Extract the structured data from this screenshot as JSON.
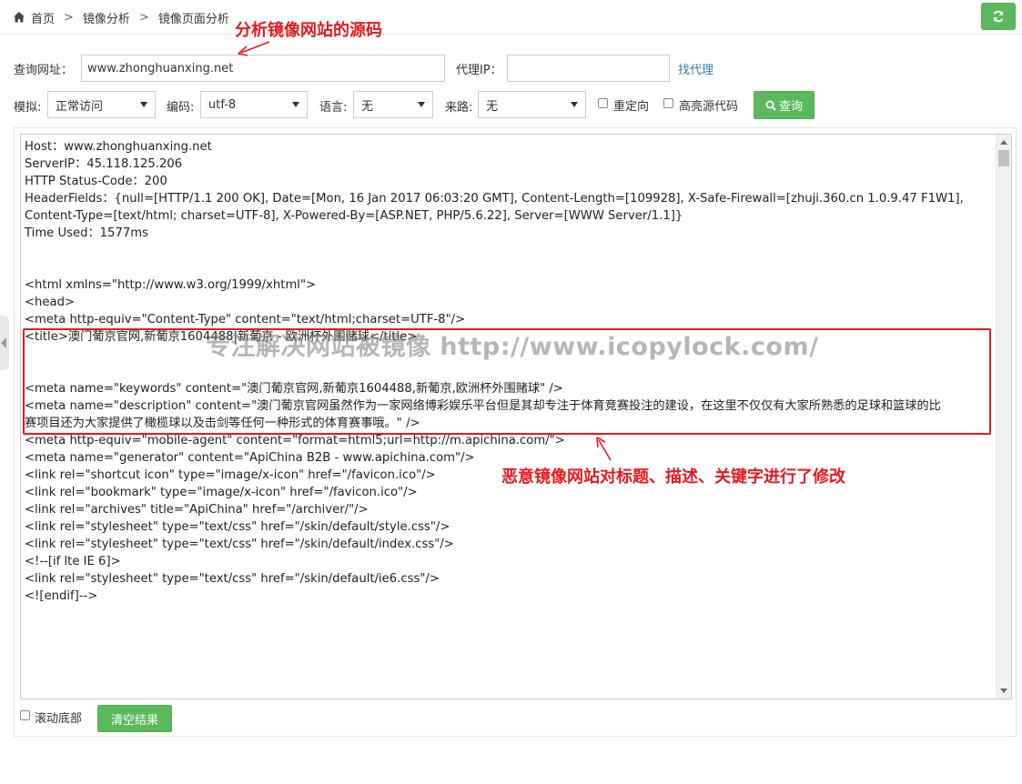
{
  "breadcrumb": {
    "items": [
      "首页",
      "镜像分析",
      "镜像页面分析"
    ],
    "separator": ">"
  },
  "form": {
    "url_label": "查询网址：",
    "url_value": "www.zhonghuanxing.net",
    "proxy_label": "代理IP：",
    "proxy_value": "",
    "find_proxy_link": "找代理",
    "mode_label": "模拟:",
    "mode_value": "正常访问",
    "encoding_label": "编码:",
    "encoding_value": "utf-8",
    "language_label": "语言:",
    "language_value": "无",
    "referrer_label": "来路:",
    "referrer_value": "无",
    "redirect_label": "重定向",
    "highlight_label": "高亮源代码",
    "query_button": "查询"
  },
  "result": {
    "lines": [
      "Host：www.zhonghuanxing.net",
      "ServerIP：45.118.125.206",
      "HTTP Status-Code：200",
      "HeaderFields：{null=[HTTP/1.1 200 OK], Date=[Mon, 16 Jan 2017 06:03:20 GMT], Content-Length=[109928], X-Safe-Firewall=[zhuji.360.cn 1.0.9.47 F1W1],",
      "Content-Type=[text/html; charset=UTF-8], X-Powered-By=[ASP.NET, PHP/5.6.22], Server=[WWW Server/1.1]}",
      "Time Used：1577ms",
      "",
      "",
      "<html xmlns=\"http://www.w3.org/1999/xhtml\">",
      "<head>",
      "<meta http-equiv=\"Content-Type\" content=\"text/html;charset=UTF-8\"/>",
      "<title>澳门葡京官网,新葡京1604488|新葡京 - 欧洲杯外围赌球</title>",
      "",
      "",
      "<meta name=\"keywords\" content=\"澳门葡京官网,新葡京1604488,新葡京,欧洲杯外围赌球\" />",
      "<meta name=\"description\" content=\"澳门葡京官网虽然作为一家网络博彩娱乐平台但是其却专注于体育竞赛投注的建设，在这里不仅仅有大家所熟悉的足球和篮球的比",
      "赛项目还为大家提供了橄榄球以及击剑等任何一种形式的体育赛事哦。\" />",
      "<meta http-equiv=\"mobile-agent\" content=\"format=html5;url=http://m.apichina.com/\">",
      "<meta name=\"generator\" content=\"ApiChina B2B - www.apichina.com\"/>",
      "<link rel=\"shortcut icon\" type=\"image/x-icon\" href=\"/favicon.ico\"/>",
      "<link rel=\"bookmark\" type=\"image/x-icon\" href=\"/favicon.ico\"/>",
      "<link rel=\"archives\" title=\"ApiChina\" href=\"/archiver/\"/>",
      "<link rel=\"stylesheet\" type=\"text/css\" href=\"/skin/default/style.css\"/>",
      "<link rel=\"stylesheet\" type=\"text/css\" href=\"/skin/default/index.css\"/>",
      "<!--[if lte IE 6]>",
      "<link rel=\"stylesheet\" type=\"text/css\" href=\"/skin/default/ie6.css\"/>",
      "<![endif]-->"
    ]
  },
  "bottom": {
    "scroll_bottom_label": "滚动底部",
    "clear_button": "清空结果"
  },
  "annotations": {
    "title_note": "分析镜像网站的源码",
    "watermark": "专注解决网站被镜像 http://www.icopylock.com/",
    "bottom_note": "恶意镜像网站对标题、描述、关键字进行了修改"
  },
  "colors": {
    "green_button": "#5cb85c",
    "annotation_red": "#e8191c",
    "link_blue": "#337ab7"
  },
  "icons": {
    "home": "home-icon",
    "refresh": "refresh-icon",
    "search": "search-icon",
    "collapse": "chevron-left-icon"
  }
}
